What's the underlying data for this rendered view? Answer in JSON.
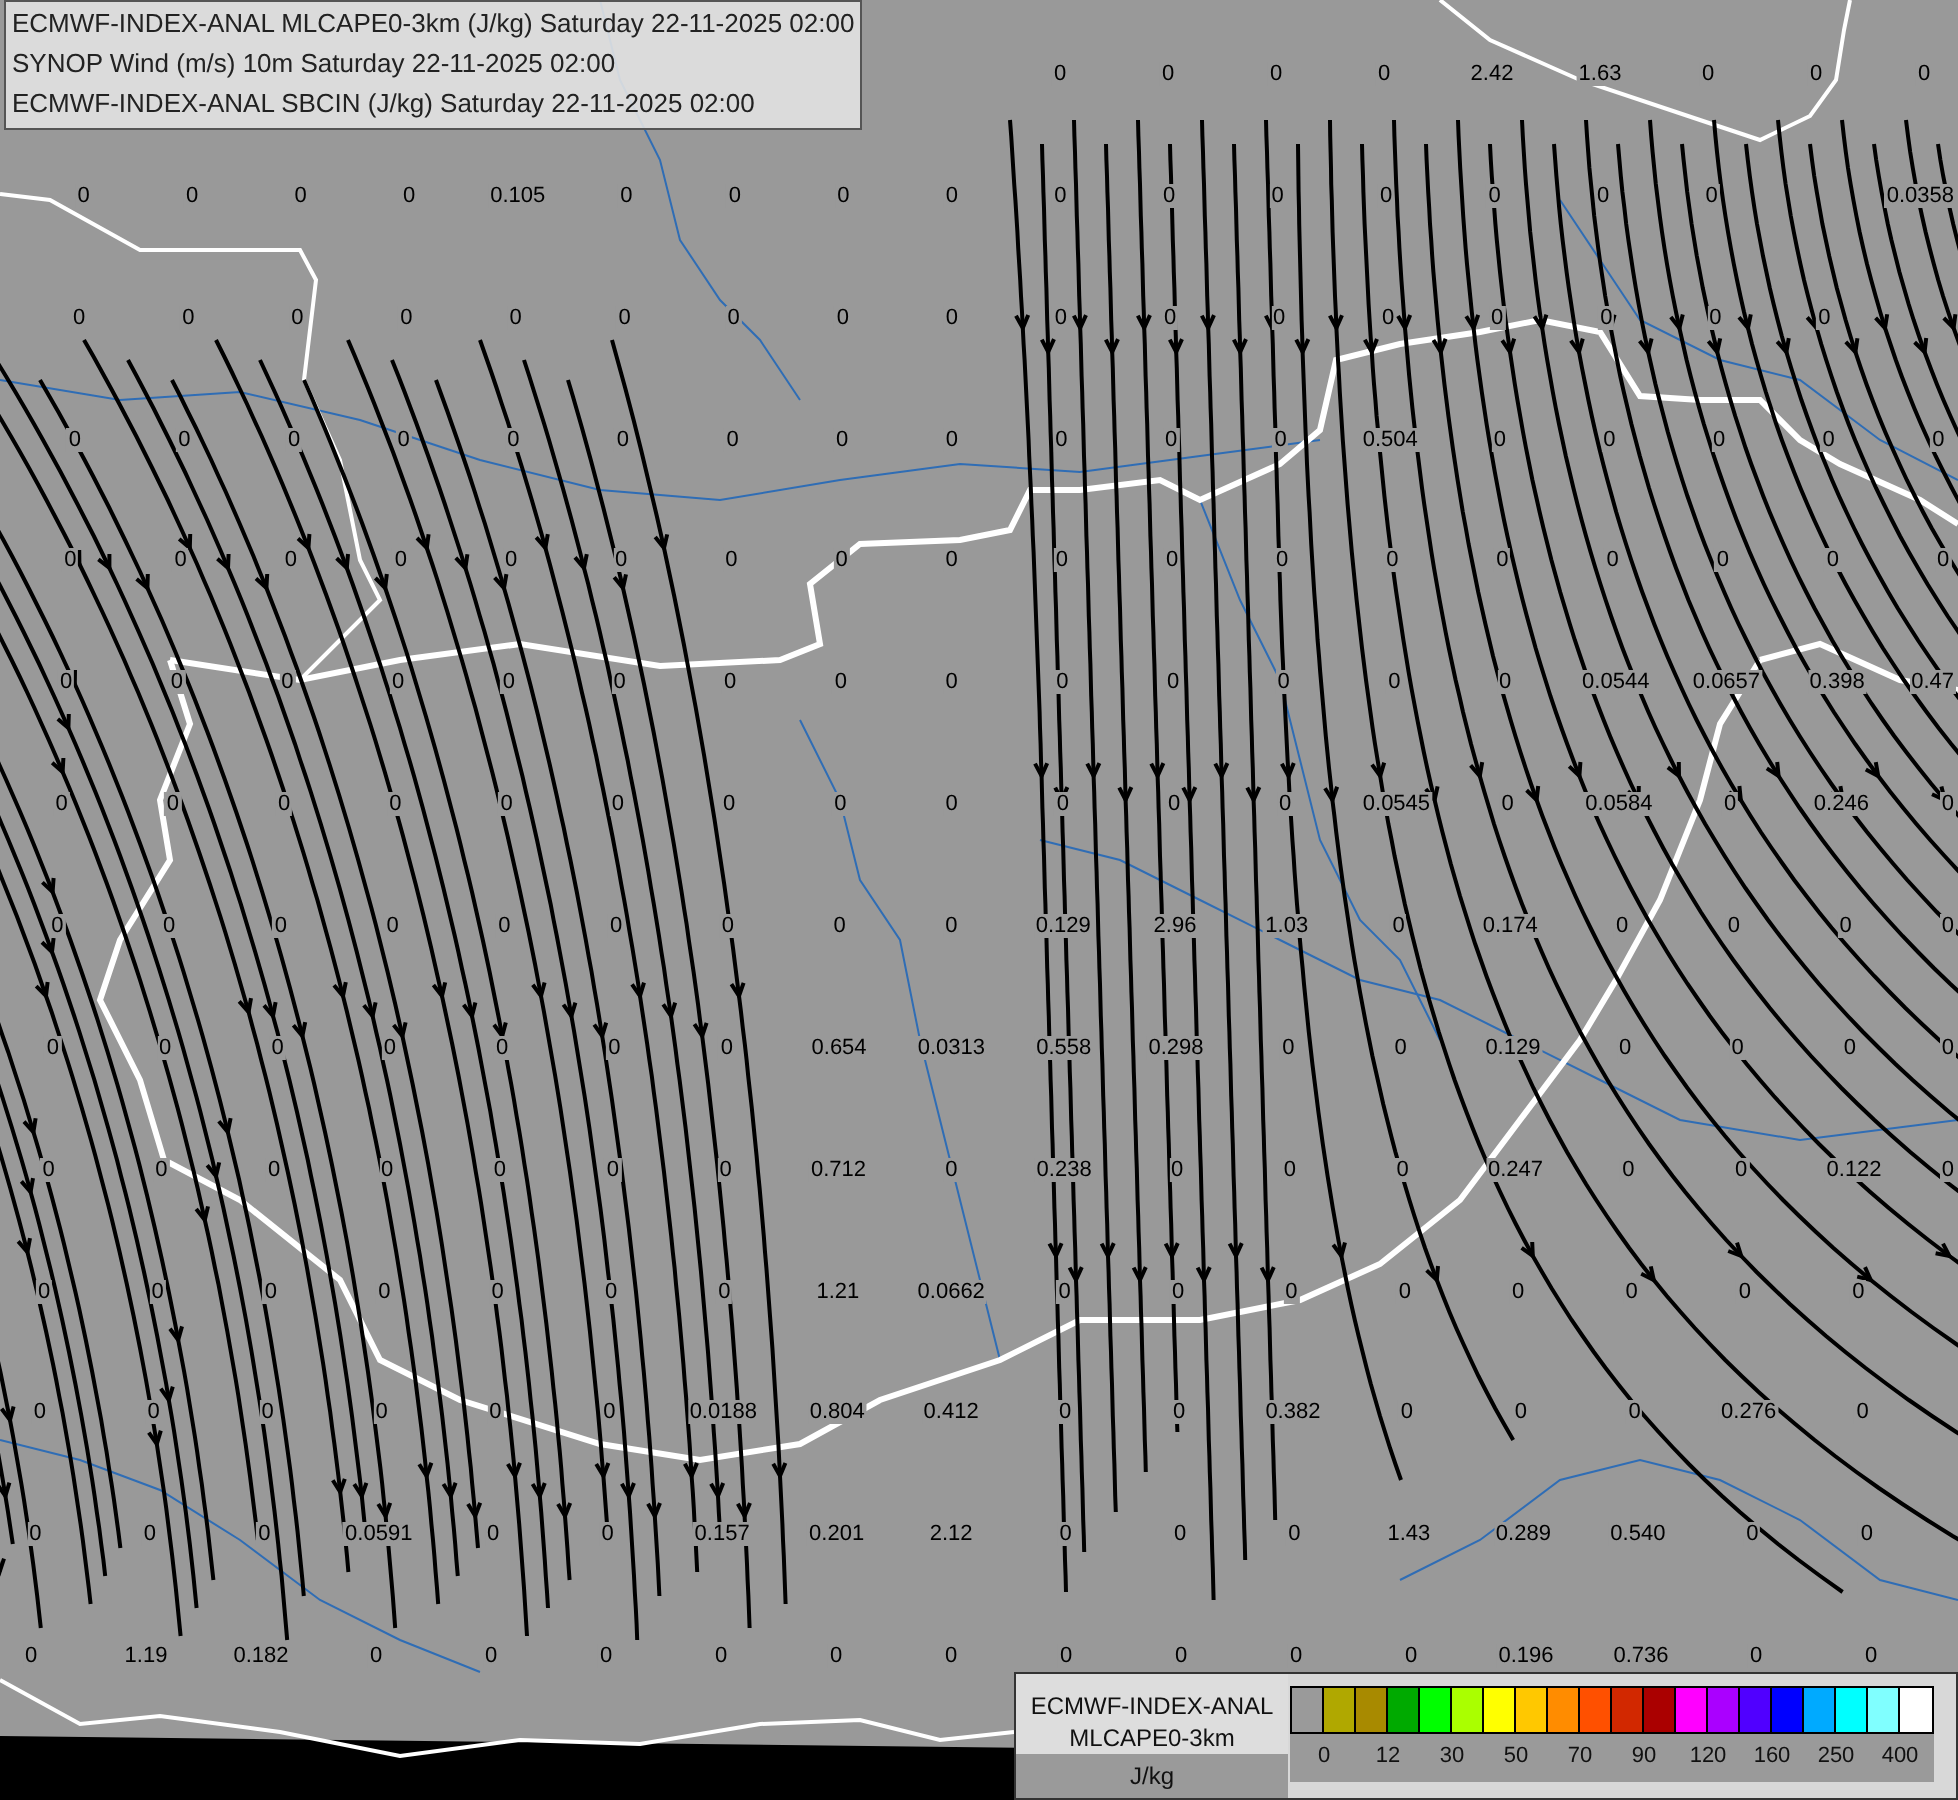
{
  "header": {
    "lines": [
      "ECMWF-INDEX-ANAL MLCAPE0-3km (J/kg) Saturday 22-11-2025 02:00",
      "SYNOP Wind (m/s) 10m Saturday 22-11-2025 02:00",
      "ECMWF-INDEX-ANAL SBCIN (J/kg) Saturday 22-11-2025 02:00"
    ]
  },
  "map": {
    "value_rows": [
      [
        null,
        null,
        null,
        null,
        null,
        null,
        null,
        null,
        null,
        "0",
        "0",
        "0",
        "0",
        "2.42",
        "1.63",
        "0",
        "0",
        "0"
      ],
      [
        "0",
        "0",
        "0",
        "0",
        "0.105",
        "0",
        "0",
        "0",
        "0",
        "0",
        "0",
        "0",
        "0",
        "0",
        "0",
        "0",
        null,
        "0.0358"
      ],
      [
        "0",
        "0",
        "0",
        "0",
        "0",
        "0",
        "0",
        "0",
        "0",
        "0",
        "0",
        "0",
        "0",
        "0",
        "0",
        "0",
        "0",
        null
      ],
      [
        "0",
        "0",
        "0",
        "0",
        "0",
        "0",
        "0",
        "0",
        "0",
        "0",
        "0",
        "0",
        "0.504",
        "0",
        "0",
        "0",
        "0",
        "0"
      ],
      [
        "0",
        "0",
        "0",
        "0",
        "0",
        "0",
        "0",
        "0",
        "0",
        "0",
        "0",
        "0",
        "0",
        "0",
        "0",
        "0",
        "0",
        "0"
      ],
      [
        "0",
        "0",
        "0",
        "0",
        "0",
        "0",
        "0",
        "0",
        "0",
        "0",
        "0",
        "0",
        "0",
        "0",
        "0.0544",
        "0.0657",
        "0.398",
        "0.47"
      ],
      [
        "0",
        "0",
        "0",
        "0",
        "0",
        "0",
        "0",
        "0",
        "0",
        "0",
        "0",
        "0",
        "0.0545",
        "0",
        "0.0584",
        "0",
        "0.246",
        "0"
      ],
      [
        "0",
        "0",
        "0",
        "0",
        "0",
        "0",
        "0",
        "0",
        "0",
        "0.129",
        "2.96",
        "1.03",
        "0",
        "0.174",
        "0",
        "0",
        "0",
        "0"
      ],
      [
        "0",
        "0",
        "0",
        "0",
        "0",
        "0",
        "0",
        "0.654",
        "0.0313",
        "0.558",
        "0.298",
        "0",
        "0",
        "0.129",
        "0",
        "0",
        "0",
        "0"
      ],
      [
        "0",
        "0",
        "0",
        "0",
        "0",
        "0",
        "0",
        "0.712",
        "0",
        "0.238",
        "0",
        "0",
        "0",
        "0.247",
        "0",
        "0",
        "0.122",
        "0"
      ],
      [
        "0",
        "0",
        "0",
        "0",
        "0",
        "0",
        "0",
        "1.21",
        "0.0662",
        "0",
        "0",
        "0",
        "0",
        "0",
        "0",
        "0",
        "0",
        null
      ],
      [
        "0",
        "0",
        "0",
        "0",
        "0",
        "0",
        "0.0188",
        "0.804",
        "0.412",
        "0",
        "0",
        "0.382",
        "0",
        "0",
        "0",
        "0.276",
        "0",
        null
      ],
      [
        "0",
        "0",
        "0",
        "0.0591",
        "0",
        "0",
        "0.157",
        "0.201",
        "2.12",
        "0",
        "0",
        "0",
        "1.43",
        "0.289",
        "0.540",
        "0",
        "0",
        null
      ],
      [
        "0",
        "1.19",
        "0.182",
        "0",
        "0",
        "0",
        "0",
        "0",
        "0",
        "0",
        "0",
        "0",
        "0",
        "0.196",
        "0.736",
        "0",
        "0",
        null
      ]
    ]
  },
  "legend": {
    "title_lines": [
      "ECMWF-INDEX-ANAL",
      "MLCAPE0-3km"
    ],
    "unit": "J/kg",
    "bins": [
      {
        "color": "#9a9a9a"
      },
      {
        "color": "#b0a800"
      },
      {
        "color": "#a88a00"
      },
      {
        "color": "#00aa00"
      },
      {
        "color": "#00ff00"
      },
      {
        "color": "#aaff00"
      },
      {
        "color": "#ffff00"
      },
      {
        "color": "#ffc800"
      },
      {
        "color": "#ff8c00"
      },
      {
        "color": "#ff5000"
      },
      {
        "color": "#d22800"
      },
      {
        "color": "#aa0000"
      },
      {
        "color": "#ff00ff"
      },
      {
        "color": "#aa00ff"
      },
      {
        "color": "#5000ff"
      },
      {
        "color": "#0000ff"
      },
      {
        "color": "#00aaff"
      },
      {
        "color": "#00ffff"
      },
      {
        "color": "#80ffff"
      },
      {
        "color": "#ffffff"
      }
    ],
    "ticks": [
      "0",
      "12",
      "30",
      "50",
      "70",
      "90",
      "120",
      "160",
      "250",
      "400"
    ]
  }
}
